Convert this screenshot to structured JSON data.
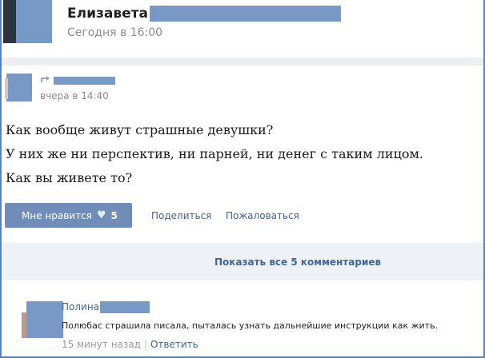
{
  "post": {
    "author_name": "Елизавета",
    "time": "Сегодня в 16:00"
  },
  "repost": {
    "time": "вчера в 14:40",
    "icon": "repost-arrow-icon"
  },
  "post_text": [
    "Как вообще живут страшные девушки?",
    "У них же ни перспектив, ни парней, ни денег с таким лицом.",
    "Как вы живете то?"
  ],
  "actions": {
    "like_label": "Мне нравится",
    "like_icon": "heart-icon",
    "like_count": "5",
    "share_label": "Поделиться",
    "report_label": "Пожаловаться"
  },
  "comments_bar": {
    "label": "Показать все 5 комментариев"
  },
  "comment": {
    "author_name": "Полина",
    "text": "Полюбас страшила писала, пыталась узнать дальнейшие инструкции как жить.",
    "time": "15 минут назад",
    "separator": "|",
    "reply_label": "Ответить"
  },
  "colors": {
    "link": "#3f6698",
    "button": "#6f8db8",
    "redaction": "#7898c6",
    "border": "#5b84b7"
  }
}
